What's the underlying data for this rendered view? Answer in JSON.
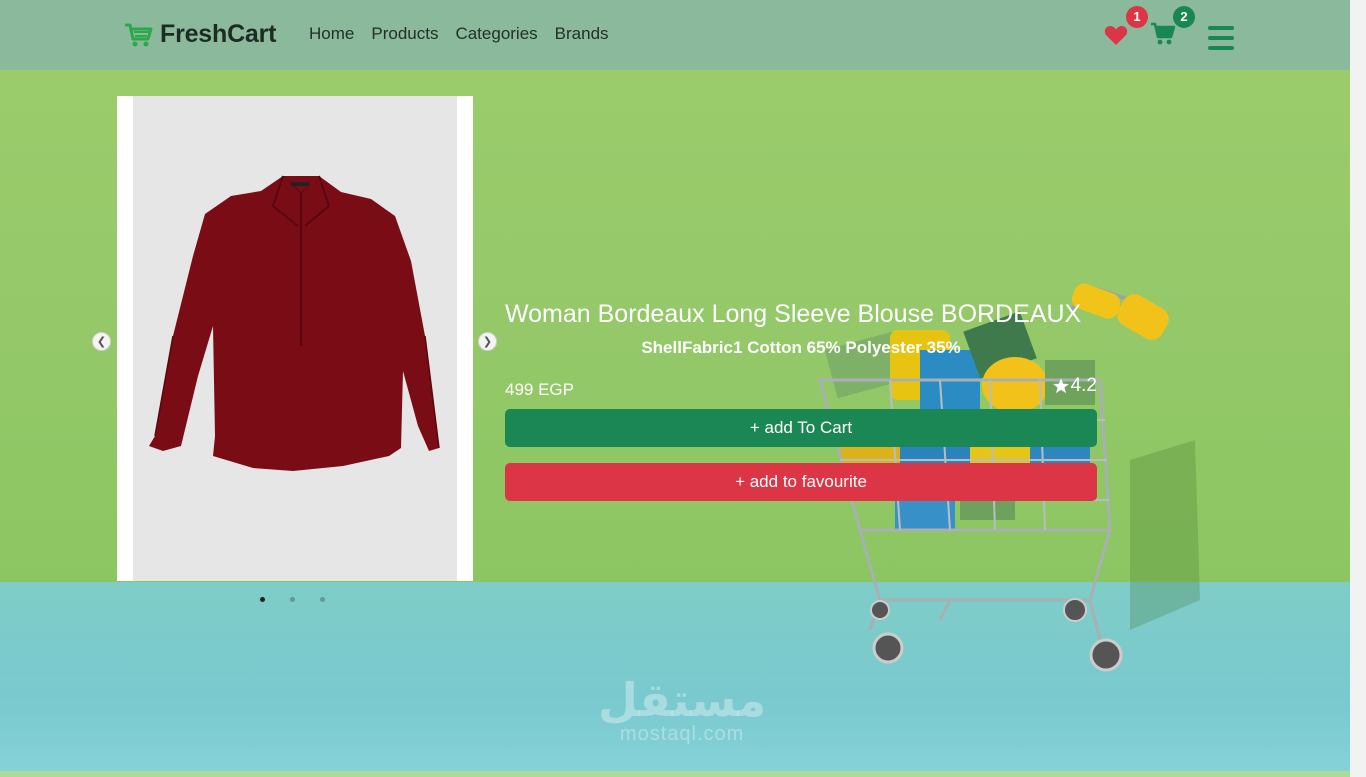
{
  "brand": {
    "name": "FreshCart",
    "icon": "cart-icon",
    "color": "#198754"
  },
  "nav": {
    "links": [
      "Home",
      "Products",
      "Categories",
      "Brands"
    ],
    "wishlist_count": "1",
    "cart_count": "2"
  },
  "carousel": {
    "slides_total": 3,
    "active_slide": 1
  },
  "product": {
    "title": "Woman Bordeaux Long Sleeve Blouse BORDEAUX",
    "description": "ShellFabric1 Cotton 65% Polyester 35%",
    "price": "499 EGP",
    "rating": "4.2",
    "image_icon": "blouse-image",
    "image_color": "#7a0c16"
  },
  "actions": {
    "add_to_cart": "+ add To Cart",
    "add_to_favourite": "+ add to favourite"
  },
  "colors": {
    "primary": "#198754",
    "danger": "#dc3545"
  },
  "watermark": {
    "arabic": "مستقل",
    "latin": "mostaql.com"
  }
}
